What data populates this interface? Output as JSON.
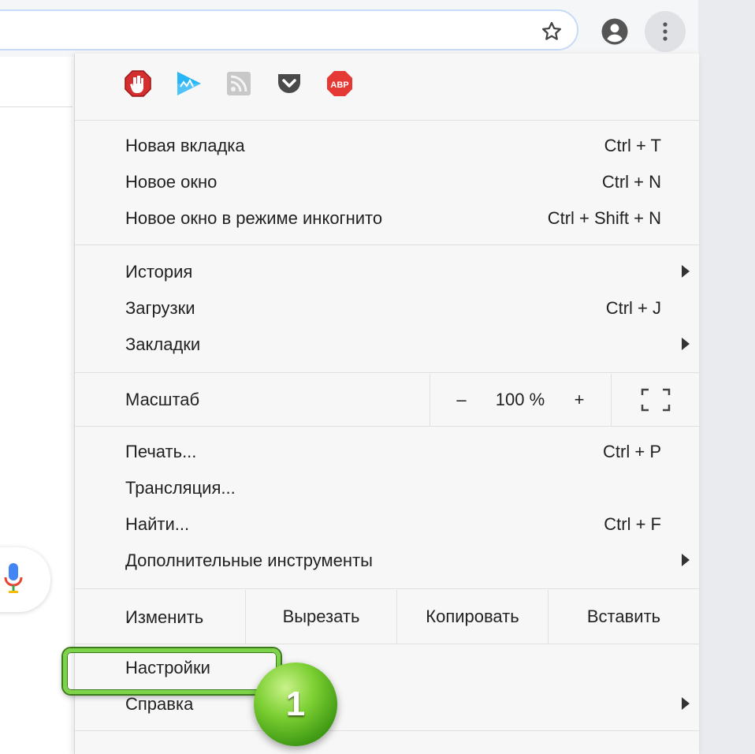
{
  "toolbar": {
    "bookmark_icon": "star-icon",
    "profile_icon": "account-icon",
    "menu_icon": "more-vert-icon"
  },
  "extensions": [
    {
      "name": "opera-adblock-icon",
      "color": "#d32f2f"
    },
    {
      "name": "play-extension-icon",
      "color": "#29b6f6"
    },
    {
      "name": "rss-icon",
      "color": "#bdbdbd"
    },
    {
      "name": "pocket-icon",
      "color": "#444444"
    },
    {
      "name": "abp-icon",
      "color": "#e53935",
      "text": "ABP"
    }
  ],
  "menu": {
    "new_tab": {
      "label": "Новая вкладка",
      "shortcut": "Ctrl + T"
    },
    "new_window": {
      "label": "Новое окно",
      "shortcut": "Ctrl + N"
    },
    "incognito": {
      "label": "Новое окно в режиме инкогнито",
      "shortcut": "Ctrl + Shift + N"
    },
    "history": {
      "label": "История"
    },
    "downloads": {
      "label": "Загрузки",
      "shortcut": "Ctrl + J"
    },
    "bookmarks": {
      "label": "Закладки"
    },
    "zoom": {
      "label": "Масштаб",
      "minus": "–",
      "value": "100 %",
      "plus": "+"
    },
    "print": {
      "label": "Печать...",
      "shortcut": "Ctrl + P"
    },
    "cast": {
      "label": "Трансляция..."
    },
    "find": {
      "label": "Найти...",
      "shortcut": "Ctrl + F"
    },
    "more_tools": {
      "label": "Дополнительные инструменты"
    },
    "edit": {
      "label": "Изменить",
      "cut": "Вырезать",
      "copy": "Копировать",
      "paste": "Вставить"
    },
    "settings": {
      "label": "Настройки"
    },
    "help": {
      "label": "Справка"
    }
  },
  "annotation": {
    "step_number": "1",
    "highlight_color": "#7dd34a",
    "badge_color": "#4caf1e"
  }
}
